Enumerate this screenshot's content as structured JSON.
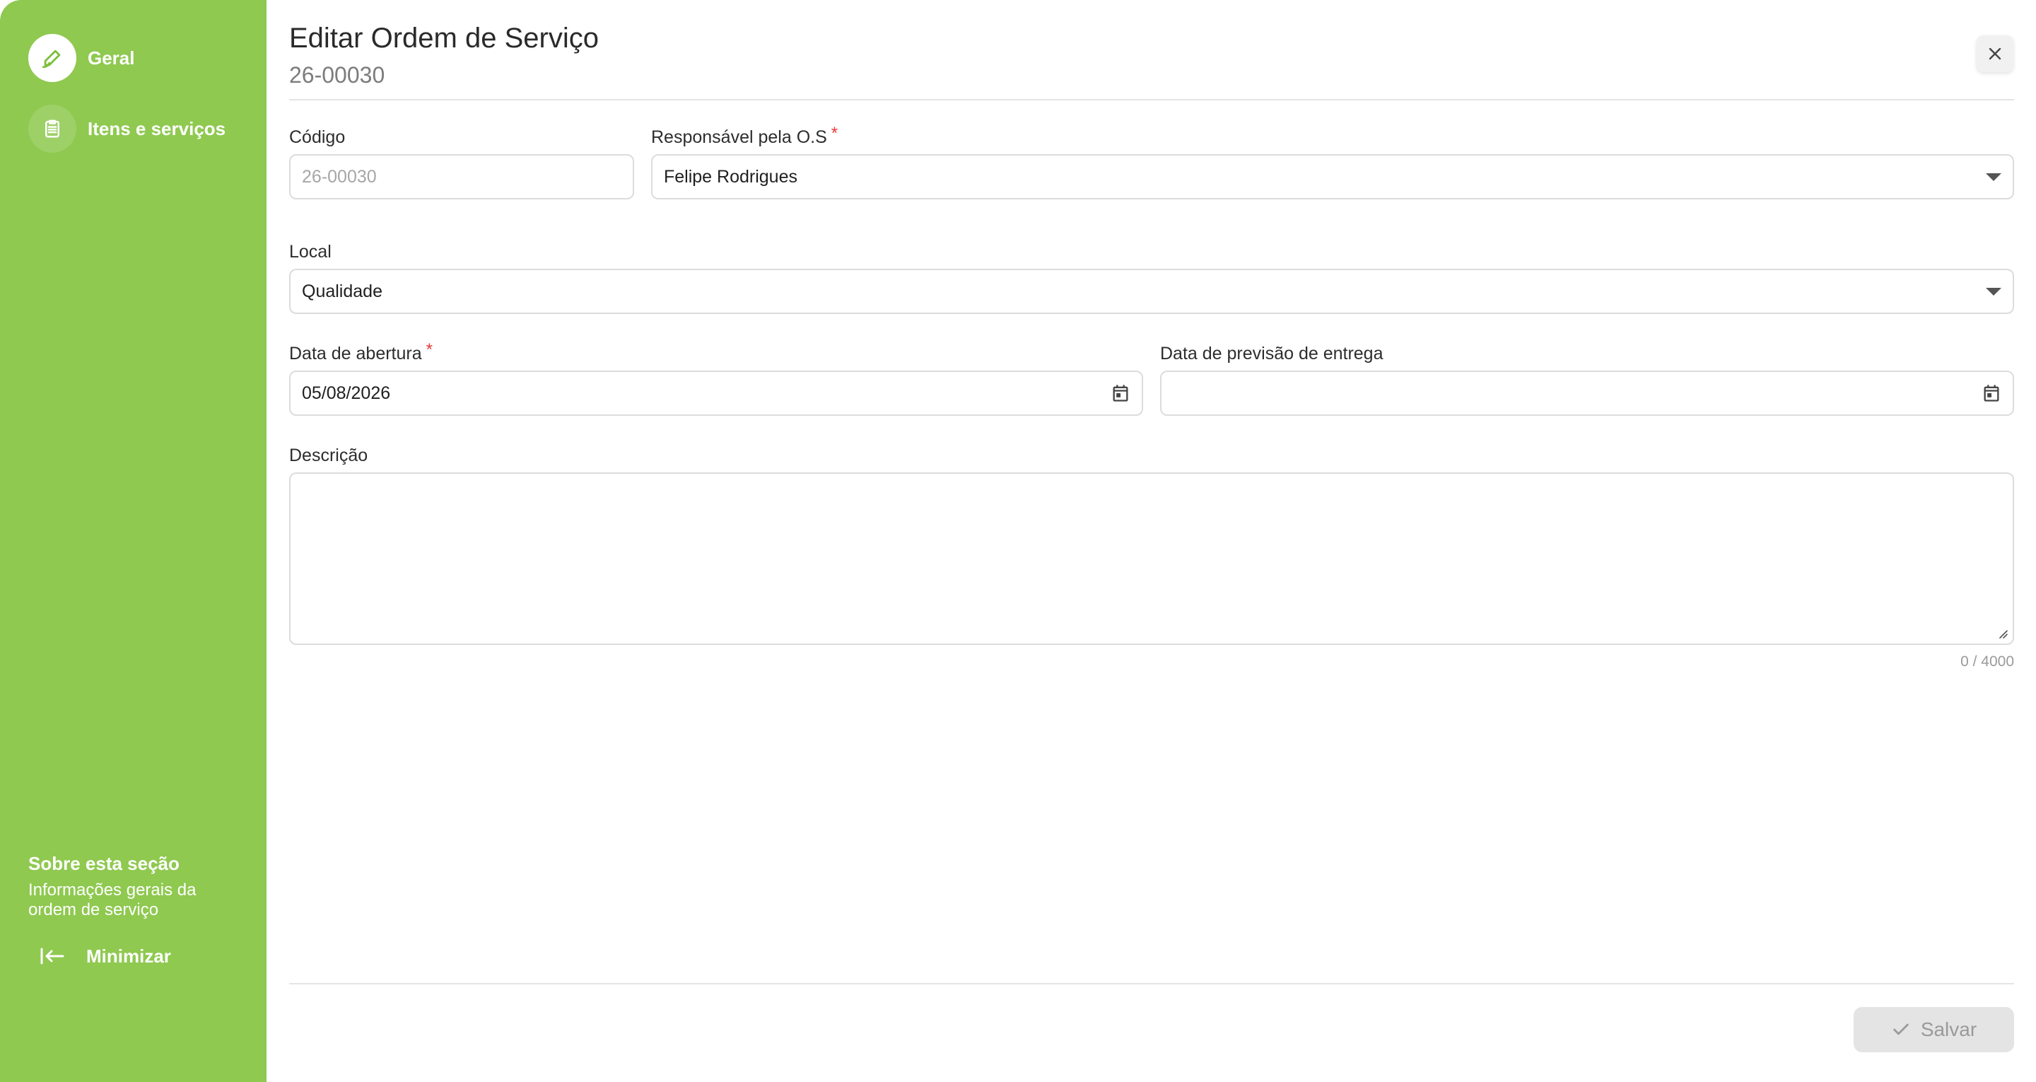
{
  "sidebar": {
    "items": [
      {
        "label": "Geral",
        "icon": "pencil-icon",
        "active": true
      },
      {
        "label": "Itens e serviços",
        "icon": "clipboard-icon",
        "active": false
      }
    ],
    "about_title": "Sobre esta seção",
    "about_text": "Informações gerais da ordem de serviço",
    "minimize_label": "Minimizar"
  },
  "header": {
    "title": "Editar Ordem de Serviço",
    "subtitle": "26-00030"
  },
  "form": {
    "codigo": {
      "label": "Código",
      "value": "26-00030"
    },
    "responsavel": {
      "label": "Responsável pela O.S",
      "required_mark": "*",
      "value": "Felipe Rodrigues"
    },
    "local": {
      "label": "Local",
      "value": "Qualidade"
    },
    "data_abertura": {
      "label": "Data de abertura",
      "required_mark": "*",
      "value": "05/08/2026"
    },
    "data_previsao": {
      "label": "Data de previsão de entrega",
      "value": ""
    },
    "descricao": {
      "label": "Descrição",
      "value": "",
      "counter": "0 / 4000"
    }
  },
  "footer": {
    "save_label": "Salvar"
  },
  "colors": {
    "sidebar_bg": "#8fc950",
    "accent": "#7cbf3a",
    "required": "#e53935"
  }
}
